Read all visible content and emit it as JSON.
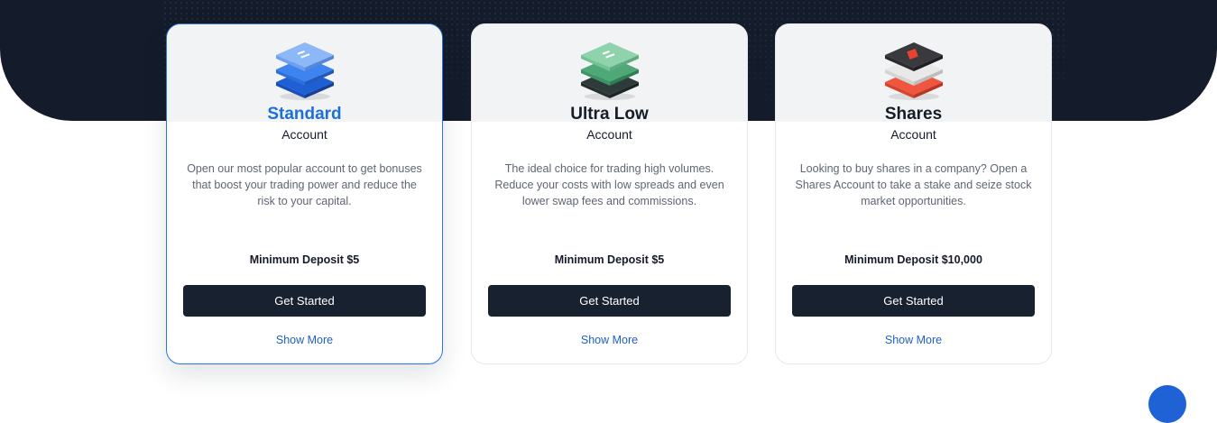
{
  "cards": [
    {
      "title": "Standard",
      "subtitle": "Account",
      "description": "Open our most popular account to get bonuses that boost your trading power and reduce the risk to your capital.",
      "deposit": "Minimum Deposit $5",
      "button": "Get Started",
      "link": "Show More",
      "icon": "stacked-layers-blue-icon",
      "selected": true
    },
    {
      "title": "Ultra Low",
      "subtitle": "Account",
      "description": "The ideal choice for trading high volumes. Reduce your costs with low spreads and even lower swap fees and commissions.",
      "deposit": "Minimum Deposit $5",
      "button": "Get Started",
      "link": "Show More",
      "icon": "stacked-layers-green-icon",
      "selected": false
    },
    {
      "title": "Shares",
      "subtitle": "Account",
      "description": "Looking to buy shares in a company? Open a Shares Account to take a stake and seize stock market opportunities.",
      "deposit": "Minimum Deposit $10,000",
      "button": "Get Started",
      "link": "Show More",
      "icon": "stacked-layers-red-icon",
      "selected": false
    }
  ],
  "colors": {
    "hero_background": "#141b2b",
    "accent_blue": "#1f6fd8",
    "button_background": "#182130",
    "link": "#1f5fc2",
    "standard_icon": "#3d84f0",
    "ultra_low_icon": "#5fb586",
    "shares_icon": "#f0553f"
  },
  "chat_button": {
    "icon": "chat-bubble-icon"
  }
}
